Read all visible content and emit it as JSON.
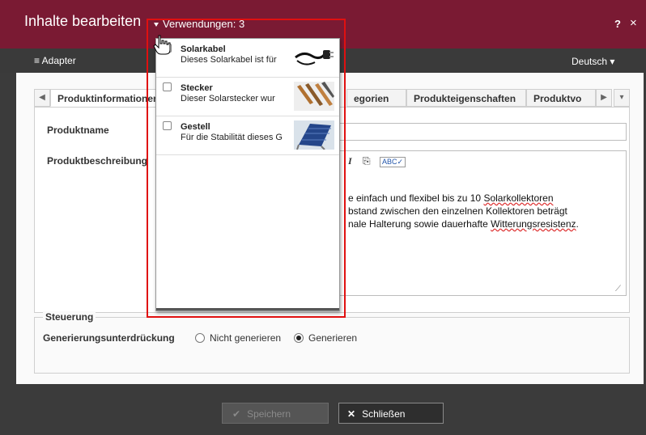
{
  "window": {
    "title": "Inhalte bearbeiten",
    "usage_label": "Verwendungen: 3",
    "help_icon": "?",
    "close_icon": "×"
  },
  "subbar": {
    "adapter_label": "≡ Adapter",
    "language_label": "Deutsch ▾"
  },
  "tabs": [
    {
      "label": "Produktinformationen"
    },
    {
      "label": "egorien"
    },
    {
      "label": "Produkteigenschaften"
    },
    {
      "label": "Produktvo"
    }
  ],
  "form": {
    "name_label": "Produktname",
    "desc_label": "Produktbeschreibung",
    "desc_lines": [
      "e einfach und flexibel bis zu 10 ",
      "bstand zwischen den einzelnen Kollektoren beträgt",
      "nale Halterung sowie dauerhafte "
    ],
    "spell_words": [
      "Solarkollektoren",
      "Witterungsresistenz"
    ],
    "desc_line3_end": "."
  },
  "steuerung": {
    "legend": "Steuerung",
    "label": "Generierungsunterdrückung",
    "options": [
      "Nicht generieren",
      "Generieren"
    ],
    "selected": "Generieren"
  },
  "buttons": {
    "save": "Speichern",
    "close": "Schließen"
  },
  "dropdown": {
    "items": [
      {
        "name": "Solarkabel",
        "desc": "Dieses Solarkabel ist für"
      },
      {
        "name": "Stecker",
        "desc": "Dieser Solarstecker wur"
      },
      {
        "name": "Gestell",
        "desc": "Für die Stabilität dieses G"
      }
    ]
  },
  "colors": {
    "title_bar": "#7a1a33",
    "highlight": "#e01010"
  }
}
